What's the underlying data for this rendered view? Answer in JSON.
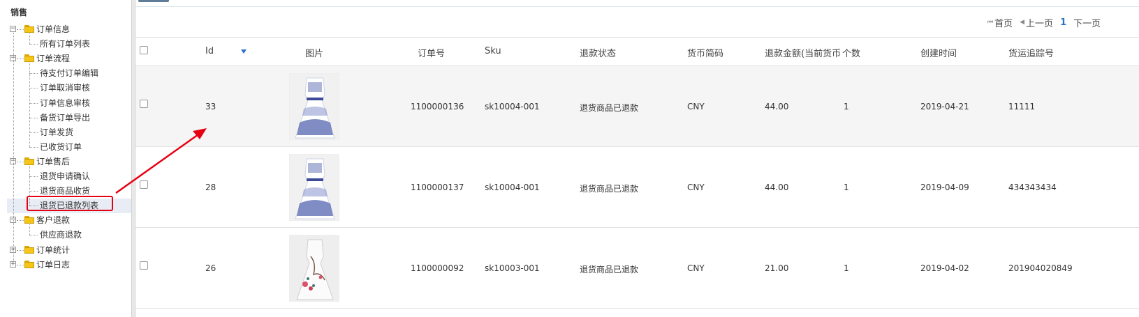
{
  "sidebar": {
    "title": "销售",
    "groups": [
      {
        "label": "订单信息",
        "toggle": "−",
        "items": [
          "所有订单列表"
        ]
      },
      {
        "label": "订单流程",
        "toggle": "−",
        "items": [
          "待支付订单编辑",
          "订单取消审核",
          "订单信息审核",
          "备货订单导出",
          "订单发货",
          "已收货订单"
        ]
      },
      {
        "label": "订单售后",
        "toggle": "−",
        "items": [
          "退货申请确认",
          "退货商品收货",
          "退货已退款列表"
        ]
      },
      {
        "label": "客户退款",
        "toggle": "−",
        "items": [
          "供应商退款"
        ]
      },
      {
        "label": "订单统计",
        "toggle": "+",
        "items": []
      },
      {
        "label": "订单日志",
        "toggle": "+",
        "items": []
      }
    ]
  },
  "pager": {
    "first": "首页",
    "prev": "上一页",
    "current": "1",
    "next": "下一页"
  },
  "table": {
    "columns": [
      "Id",
      "图片",
      "订单号",
      "Sku",
      "退款状态",
      "货币简码",
      "退款金额(当前货币)",
      "个数",
      "创建时间",
      "货运追踪号"
    ],
    "rows": [
      {
        "id": "33",
        "order_no": "1100000136",
        "sku": "sk10004-001",
        "status": "退货商品已退款",
        "currency": "CNY",
        "amount": "44.00",
        "qty": "1",
        "created": "2019-04-21",
        "tracking": "11111",
        "image": "blue-floral-dress"
      },
      {
        "id": "28",
        "order_no": "1100000137",
        "sku": "sk10004-001",
        "status": "退货商品已退款",
        "currency": "CNY",
        "amount": "44.00",
        "qty": "1",
        "created": "2019-04-09",
        "tracking": "434343434",
        "image": "blue-floral-dress"
      },
      {
        "id": "26",
        "order_no": "1100000092",
        "sku": "sk10003-001",
        "status": "退货商品已退款",
        "currency": "CNY",
        "amount": "21.00",
        "qty": "1",
        "created": "2019-04-02",
        "tracking": "201904020849",
        "image": "white-plum-blossom-dress"
      }
    ]
  },
  "colors": {
    "annotation": "#e60012",
    "link": "#2a74c5",
    "folder": "#f5c518"
  }
}
